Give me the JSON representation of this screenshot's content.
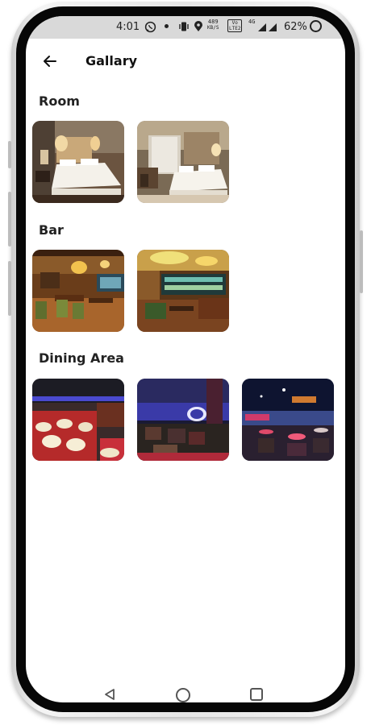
{
  "status_bar": {
    "time": "4:01",
    "speed_value": "489",
    "speed_unit": "KB/S",
    "volte_top": "Vo",
    "volte_bottom": "LTE2",
    "network": "4G",
    "battery": "62%"
  },
  "app_bar": {
    "title": "Gallary",
    "back_icon": "arrow-left-icon"
  },
  "sections": [
    {
      "title": "Room",
      "images": [
        "hotel-room-photo-1",
        "hotel-room-photo-2"
      ]
    },
    {
      "title": "Bar",
      "images": [
        "bar-photo-1",
        "bar-photo-2"
      ]
    },
    {
      "title": "Dining Area",
      "images": [
        "dining-area-photo-1",
        "dining-area-photo-2",
        "dining-area-photo-3"
      ]
    }
  ],
  "nav_bar": {
    "icons": [
      "nav-back-triangle-icon",
      "nav-home-circle-icon",
      "nav-recent-square-icon"
    ]
  }
}
